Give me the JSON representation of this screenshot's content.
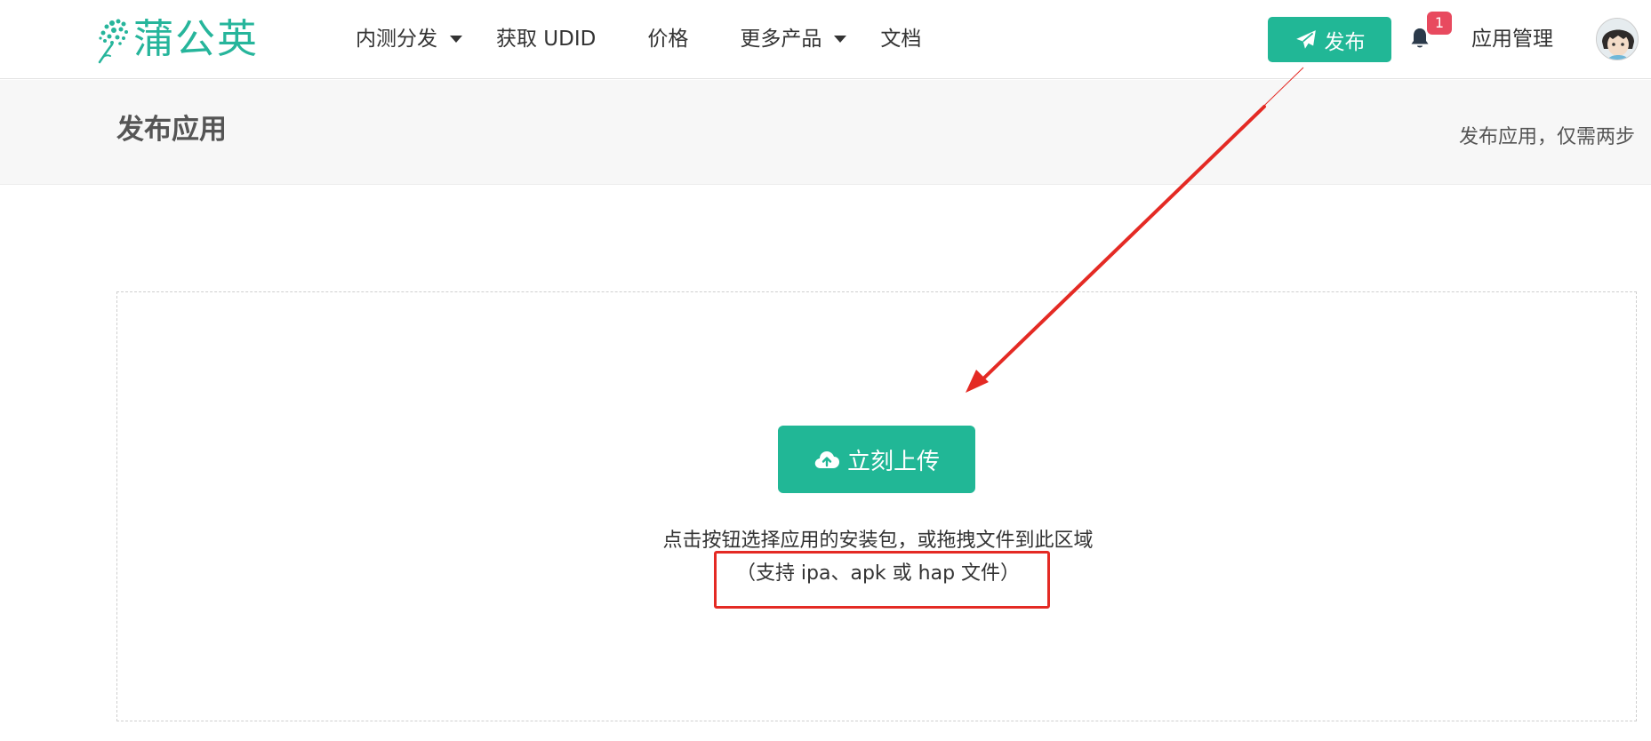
{
  "brand": {
    "name": "蒲公英",
    "color": "#26b59b"
  },
  "nav": {
    "items": [
      {
        "label": "内测分发",
        "has_dropdown": true
      },
      {
        "label": "获取 UDID",
        "has_dropdown": false
      },
      {
        "label": "价格",
        "has_dropdown": false
      },
      {
        "label": "更多产品",
        "has_dropdown": true
      },
      {
        "label": "文档",
        "has_dropdown": false
      }
    ],
    "publish_label": "发布",
    "notification_count": "1",
    "app_manage_label": "应用管理"
  },
  "page": {
    "title": "发布应用",
    "subtitle": "发布应用，仅需两步"
  },
  "upload": {
    "button_label": "立刻上传",
    "hint_line1": "点击按钮选择应用的安装包，或拖拽文件到此区域",
    "hint_line2": "（支持 ipa、apk 或 hap 文件）"
  },
  "colors": {
    "accent": "#21b796",
    "badge": "#e84a5f",
    "annotation": "#e42a24"
  }
}
